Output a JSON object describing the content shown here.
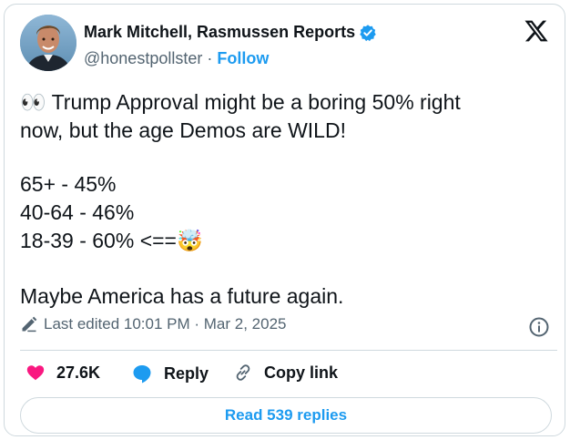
{
  "author": {
    "name": "Mark Mitchell, Rasmussen Reports",
    "handle": "@honestpollster",
    "separator": "·",
    "follow_label": "Follow",
    "verified": true
  },
  "tweet": {
    "line1": "👀 Trump Approval might be a boring 50% right",
    "line2": "now, but the age Demos are WILD!",
    "stats": [
      "65+ - 45%",
      "40-64 - 46%",
      "18-39 - 60% <==🤯"
    ],
    "closing": "Maybe America has a future again."
  },
  "meta": {
    "edited_text": "Last edited 10:01 PM · Mar 2, 2025"
  },
  "actions": {
    "likes_count": "27.6K",
    "reply_label": "Reply",
    "copy_link_label": "Copy link"
  },
  "read_replies_label": "Read 539 replies",
  "colors": {
    "accent": "#1d9bf0",
    "like": "#f91880",
    "text": "#0f1419",
    "muted": "#536471",
    "border": "#cfd9de"
  }
}
